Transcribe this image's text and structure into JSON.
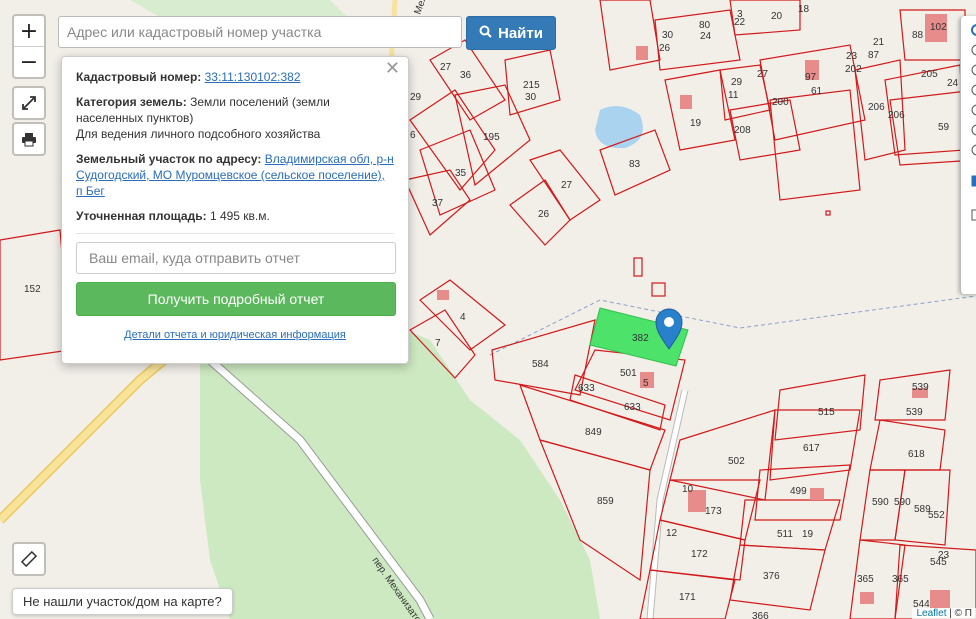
{
  "search": {
    "placeholder": "Адрес или кадастровый номер участка",
    "button_label": "Найти"
  },
  "zoom": {
    "in_label": "+",
    "out_label": "−"
  },
  "popup": {
    "close_label": "✕",
    "cadastral_label": "Кадастровый номер:",
    "cadastral_value": "33:11:130102:382",
    "category_label": "Категория земель:",
    "category_value": "Земли поселений (земли населенных пунктов)",
    "usage_value": "Для ведения личного подсобного хозяйства",
    "address_label": "Земельный участок по адресу:",
    "address_value": "Владимирская обл, р-н Судогодский, МО Муромцевское (сельское поселение), п Бег",
    "area_label": "Уточненная площадь:",
    "area_value": "1 495 кв.м.",
    "email_placeholder": "Ваш email, куда отправить отчет",
    "report_button": "Получить подробный отчет",
    "details_link": "Детали отчета и юридическая информация"
  },
  "not_found_button": "Не нашли участок/дом на карте?",
  "attribution": {
    "leaflet": "Leaflet",
    "rest": "| © П"
  },
  "map": {
    "selected_parcel": "382",
    "street_label": "пер. Механизатор",
    "street_label_top": "Меха",
    "parcel_numbers": [
      "152",
      "6",
      "27",
      "36",
      "215",
      "30",
      "29",
      "195",
      "35",
      "37",
      "27",
      "26",
      "83",
      "4",
      "7",
      "584",
      "501",
      "5",
      "633",
      "633",
      "849",
      "859",
      "515",
      "617",
      "502",
      "499",
      "173",
      "511",
      "19",
      "172",
      "376",
      "171",
      "366",
      "539",
      "539",
      "618",
      "590",
      "590",
      "589",
      "552",
      "545",
      "23",
      "365",
      "365",
      "544",
      "30",
      "26",
      "80",
      "24",
      "3",
      "22",
      "20",
      "18",
      "88",
      "102",
      "21",
      "87",
      "23",
      "202",
      "29",
      "27",
      "11",
      "61",
      "97",
      "200",
      "206",
      "206",
      "19",
      "208",
      "205",
      "24",
      "59",
      "12",
      "10"
    ],
    "colors": {
      "parcel_line": "#d11a1a",
      "selected_fill": "#4de36b",
      "forest": "#cde9c1",
      "water": "#aad3f0",
      "road": "#f7d37a",
      "building": "#e78b8b"
    }
  },
  "layers_panel": {
    "visible": true
  }
}
